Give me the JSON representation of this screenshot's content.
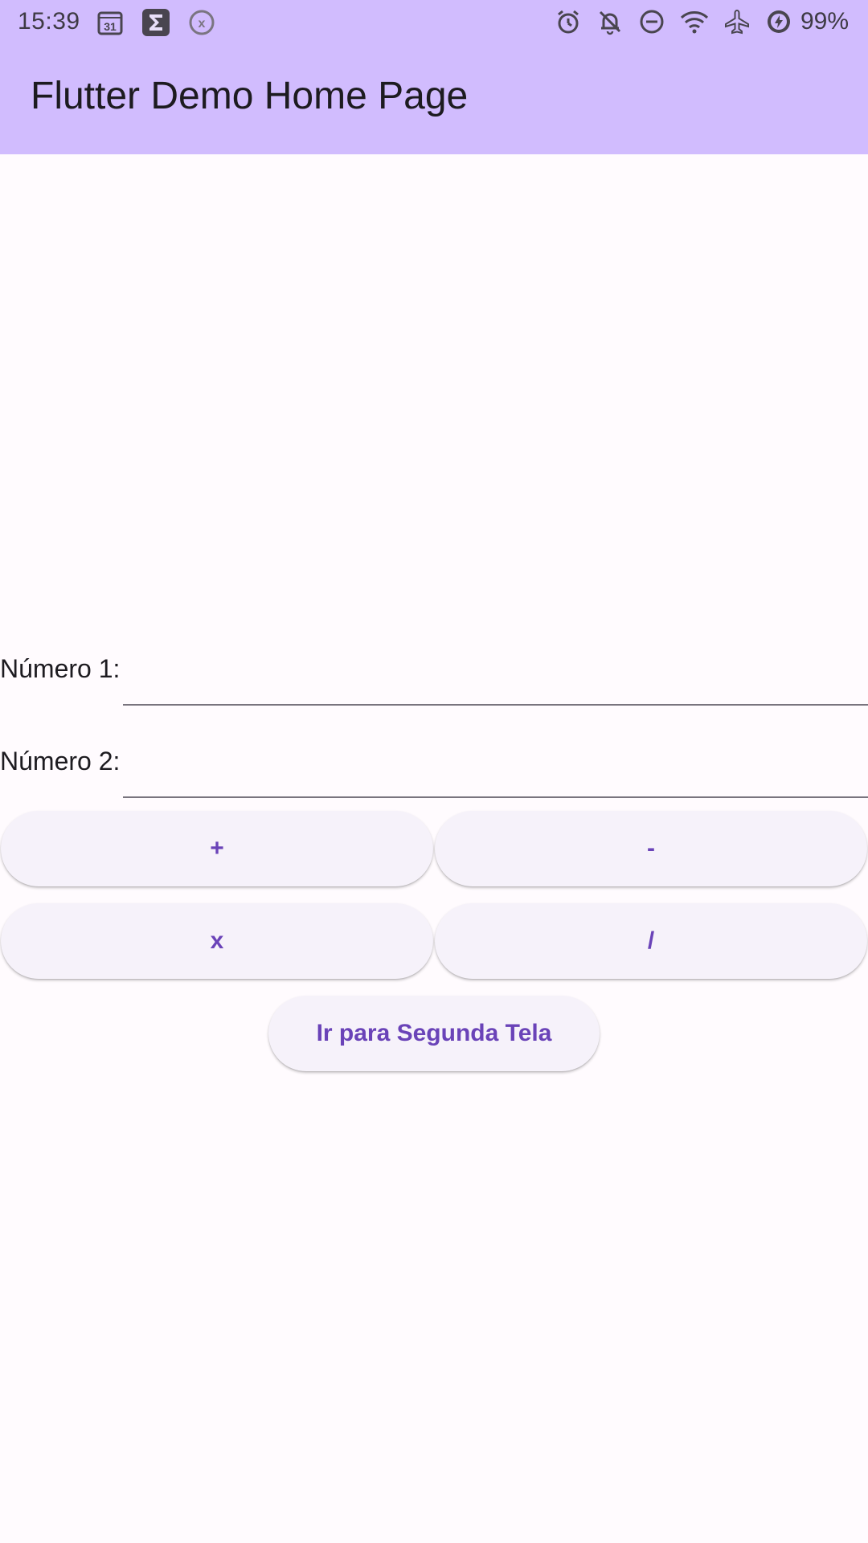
{
  "status_bar": {
    "time": "15:39",
    "left_icons": [
      "calendar-icon",
      "sigma-icon",
      "x-circle-icon"
    ],
    "calendar_day": "31",
    "right_icons": [
      "alarm-icon",
      "notifications-off-icon",
      "do-not-disturb-icon",
      "wifi-icon",
      "airplane-icon",
      "battery-saver-icon"
    ],
    "battery": "99%"
  },
  "app_bar": {
    "title": "Flutter Demo Home Page",
    "background": "#D1BCFE"
  },
  "form": {
    "number1_label": "Número 1:",
    "number1_value": "",
    "number2_label": "Número 2:",
    "number2_value": ""
  },
  "buttons": {
    "add": "+",
    "subtract": "-",
    "multiply": "x",
    "divide": "/",
    "navigate": "Ir para Segunda Tela"
  },
  "colors": {
    "accent": "#6A43B8",
    "button_bg": "#F6F2FA",
    "page_bg": "#FFFBFE"
  }
}
